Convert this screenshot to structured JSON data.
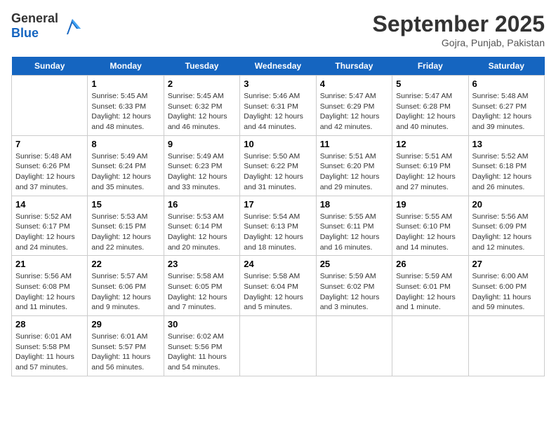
{
  "header": {
    "logo_general": "General",
    "logo_blue": "Blue",
    "month_title": "September 2025",
    "subtitle": "Gojra, Punjab, Pakistan"
  },
  "days_of_week": [
    "Sunday",
    "Monday",
    "Tuesday",
    "Wednesday",
    "Thursday",
    "Friday",
    "Saturday"
  ],
  "weeks": [
    [
      {
        "day": "",
        "info": ""
      },
      {
        "day": "1",
        "info": "Sunrise: 5:45 AM\nSunset: 6:33 PM\nDaylight: 12 hours\nand 48 minutes."
      },
      {
        "day": "2",
        "info": "Sunrise: 5:45 AM\nSunset: 6:32 PM\nDaylight: 12 hours\nand 46 minutes."
      },
      {
        "day": "3",
        "info": "Sunrise: 5:46 AM\nSunset: 6:31 PM\nDaylight: 12 hours\nand 44 minutes."
      },
      {
        "day": "4",
        "info": "Sunrise: 5:47 AM\nSunset: 6:29 PM\nDaylight: 12 hours\nand 42 minutes."
      },
      {
        "day": "5",
        "info": "Sunrise: 5:47 AM\nSunset: 6:28 PM\nDaylight: 12 hours\nand 40 minutes."
      },
      {
        "day": "6",
        "info": "Sunrise: 5:48 AM\nSunset: 6:27 PM\nDaylight: 12 hours\nand 39 minutes."
      }
    ],
    [
      {
        "day": "7",
        "info": "Sunrise: 5:48 AM\nSunset: 6:26 PM\nDaylight: 12 hours\nand 37 minutes."
      },
      {
        "day": "8",
        "info": "Sunrise: 5:49 AM\nSunset: 6:24 PM\nDaylight: 12 hours\nand 35 minutes."
      },
      {
        "day": "9",
        "info": "Sunrise: 5:49 AM\nSunset: 6:23 PM\nDaylight: 12 hours\nand 33 minutes."
      },
      {
        "day": "10",
        "info": "Sunrise: 5:50 AM\nSunset: 6:22 PM\nDaylight: 12 hours\nand 31 minutes."
      },
      {
        "day": "11",
        "info": "Sunrise: 5:51 AM\nSunset: 6:20 PM\nDaylight: 12 hours\nand 29 minutes."
      },
      {
        "day": "12",
        "info": "Sunrise: 5:51 AM\nSunset: 6:19 PM\nDaylight: 12 hours\nand 27 minutes."
      },
      {
        "day": "13",
        "info": "Sunrise: 5:52 AM\nSunset: 6:18 PM\nDaylight: 12 hours\nand 26 minutes."
      }
    ],
    [
      {
        "day": "14",
        "info": "Sunrise: 5:52 AM\nSunset: 6:17 PM\nDaylight: 12 hours\nand 24 minutes."
      },
      {
        "day": "15",
        "info": "Sunrise: 5:53 AM\nSunset: 6:15 PM\nDaylight: 12 hours\nand 22 minutes."
      },
      {
        "day": "16",
        "info": "Sunrise: 5:53 AM\nSunset: 6:14 PM\nDaylight: 12 hours\nand 20 minutes."
      },
      {
        "day": "17",
        "info": "Sunrise: 5:54 AM\nSunset: 6:13 PM\nDaylight: 12 hours\nand 18 minutes."
      },
      {
        "day": "18",
        "info": "Sunrise: 5:55 AM\nSunset: 6:11 PM\nDaylight: 12 hours\nand 16 minutes."
      },
      {
        "day": "19",
        "info": "Sunrise: 5:55 AM\nSunset: 6:10 PM\nDaylight: 12 hours\nand 14 minutes."
      },
      {
        "day": "20",
        "info": "Sunrise: 5:56 AM\nSunset: 6:09 PM\nDaylight: 12 hours\nand 12 minutes."
      }
    ],
    [
      {
        "day": "21",
        "info": "Sunrise: 5:56 AM\nSunset: 6:08 PM\nDaylight: 12 hours\nand 11 minutes."
      },
      {
        "day": "22",
        "info": "Sunrise: 5:57 AM\nSunset: 6:06 PM\nDaylight: 12 hours\nand 9 minutes."
      },
      {
        "day": "23",
        "info": "Sunrise: 5:58 AM\nSunset: 6:05 PM\nDaylight: 12 hours\nand 7 minutes."
      },
      {
        "day": "24",
        "info": "Sunrise: 5:58 AM\nSunset: 6:04 PM\nDaylight: 12 hours\nand 5 minutes."
      },
      {
        "day": "25",
        "info": "Sunrise: 5:59 AM\nSunset: 6:02 PM\nDaylight: 12 hours\nand 3 minutes."
      },
      {
        "day": "26",
        "info": "Sunrise: 5:59 AM\nSunset: 6:01 PM\nDaylight: 12 hours\nand 1 minute."
      },
      {
        "day": "27",
        "info": "Sunrise: 6:00 AM\nSunset: 6:00 PM\nDaylight: 11 hours\nand 59 minutes."
      }
    ],
    [
      {
        "day": "28",
        "info": "Sunrise: 6:01 AM\nSunset: 5:58 PM\nDaylight: 11 hours\nand 57 minutes."
      },
      {
        "day": "29",
        "info": "Sunrise: 6:01 AM\nSunset: 5:57 PM\nDaylight: 11 hours\nand 56 minutes."
      },
      {
        "day": "30",
        "info": "Sunrise: 6:02 AM\nSunset: 5:56 PM\nDaylight: 11 hours\nand 54 minutes."
      },
      {
        "day": "",
        "info": ""
      },
      {
        "day": "",
        "info": ""
      },
      {
        "day": "",
        "info": ""
      },
      {
        "day": "",
        "info": ""
      }
    ]
  ]
}
